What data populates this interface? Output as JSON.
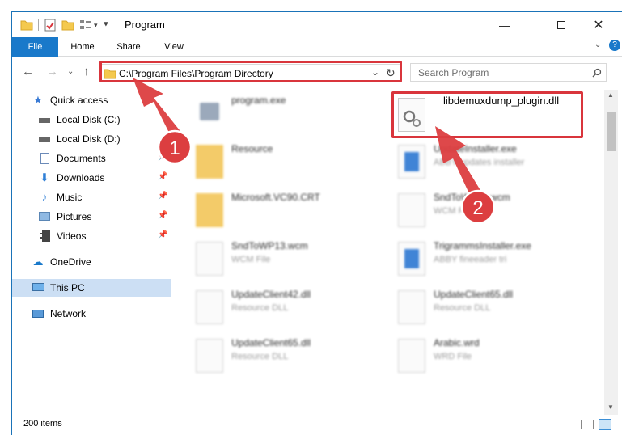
{
  "window": {
    "title": "Program"
  },
  "ribbon": {
    "tabs": [
      "File",
      "Home",
      "Share",
      "View"
    ]
  },
  "address": {
    "path": "C:\\Program Files\\Program Directory"
  },
  "search": {
    "placeholder": "Search Program"
  },
  "sidebar": {
    "quick_access": "Quick access",
    "items": [
      {
        "label": "Local Disk (C:)",
        "icon": "drive-icon",
        "pinned": false
      },
      {
        "label": "Local Disk (D:)",
        "icon": "drive-icon",
        "pinned": false
      },
      {
        "label": "Documents",
        "icon": "documents-icon",
        "pinned": true
      },
      {
        "label": "Downloads",
        "icon": "downloads-icon",
        "pinned": true
      },
      {
        "label": "Music",
        "icon": "music-icon",
        "pinned": true
      },
      {
        "label": "Pictures",
        "icon": "pictures-icon",
        "pinned": true
      },
      {
        "label": "Videos",
        "icon": "videos-icon",
        "pinned": true
      }
    ],
    "onedrive": "OneDrive",
    "thispc": "This PC",
    "network": "Network"
  },
  "files": [
    {
      "name": "program.exe",
      "sub": ""
    },
    {
      "name": "libdemuxdump_plugin.dll",
      "sub": ""
    },
    {
      "name": "Resource",
      "sub": ""
    },
    {
      "name": "UpdateInstaller.exe",
      "sub": "ABBY updates installer"
    },
    {
      "name": "Microsoft.VC90.CRT",
      "sub": ""
    },
    {
      "name": "SndToWP13.wcm",
      "sub": "WCM File"
    },
    {
      "name": "SndToWP13.wcm",
      "sub": "WCM File"
    },
    {
      "name": "TrigrammsInstaller.exe",
      "sub": "ABBY fineeader tri"
    },
    {
      "name": "UpdateClient42.dll",
      "sub": "Resource DLL"
    },
    {
      "name": "UpdateClient65.dll",
      "sub": "Resource DLL"
    },
    {
      "name": "UpdateClient65.dll",
      "sub": "Resource DLL"
    },
    {
      "name": "Arabic.wrd",
      "sub": "WRD File"
    }
  ],
  "status": {
    "count": "200 items"
  },
  "annotations": {
    "step1": "1",
    "step2": "2"
  },
  "colors": {
    "accent": "#1979ca",
    "highlight": "#d9353c",
    "selected": "#ccdff4"
  }
}
